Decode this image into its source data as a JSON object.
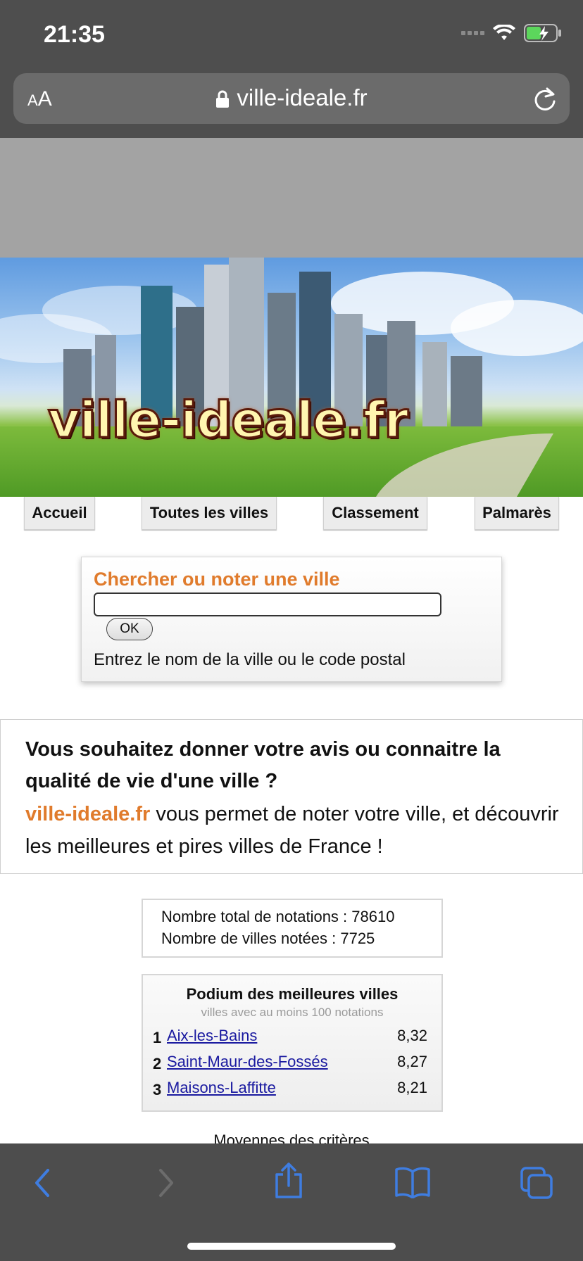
{
  "status_bar": {
    "time": "21:35"
  },
  "url_bar": {
    "aa_label_small": "A",
    "aa_label_large": "A",
    "url": "ville-ideale.fr"
  },
  "banner": {
    "title": "ville-ideale.fr"
  },
  "nav": {
    "items": [
      "Accueil",
      "Toutes les villes",
      "Classement",
      "Palmarès"
    ]
  },
  "search": {
    "title": "Chercher ou noter une ville",
    "input_value": "",
    "button_label": "OK",
    "hint": "Entrez le nom de la ville ou le code postal"
  },
  "intro": {
    "question": "Vous souhaitez donner votre avis ou connaitre la qualité de vie d'une ville ?",
    "brand": "ville-ideale.fr",
    "description": " vous permet de noter votre ville, et découvrir les meilleures et pires villes de France !"
  },
  "stats": {
    "total_ratings": "Nombre total de notations : 78610",
    "rated_cities": "Nombre de villes notées : 7725"
  },
  "podium": {
    "title": "Podium des meilleures villes",
    "subtitle": "villes avec au moins 100 notations",
    "rows": [
      {
        "rank": "1",
        "city": "Aix-les-Bains",
        "score": "8,32"
      },
      {
        "rank": "2",
        "city": "Saint-Maur-des-Fossés",
        "score": "8,27"
      },
      {
        "rank": "3",
        "city": "Maisons-Laffitte",
        "score": "8,21"
      }
    ]
  },
  "next_section_heading": "Moyennes des critères",
  "colors": {
    "accent": "#e07b2c",
    "link": "#1a1aa0",
    "toolbar_icons": "#3f7de0"
  },
  "toolbar": {
    "icons": [
      "back-icon",
      "forward-icon",
      "share-icon",
      "bookmarks-icon",
      "tabs-icon"
    ]
  }
}
